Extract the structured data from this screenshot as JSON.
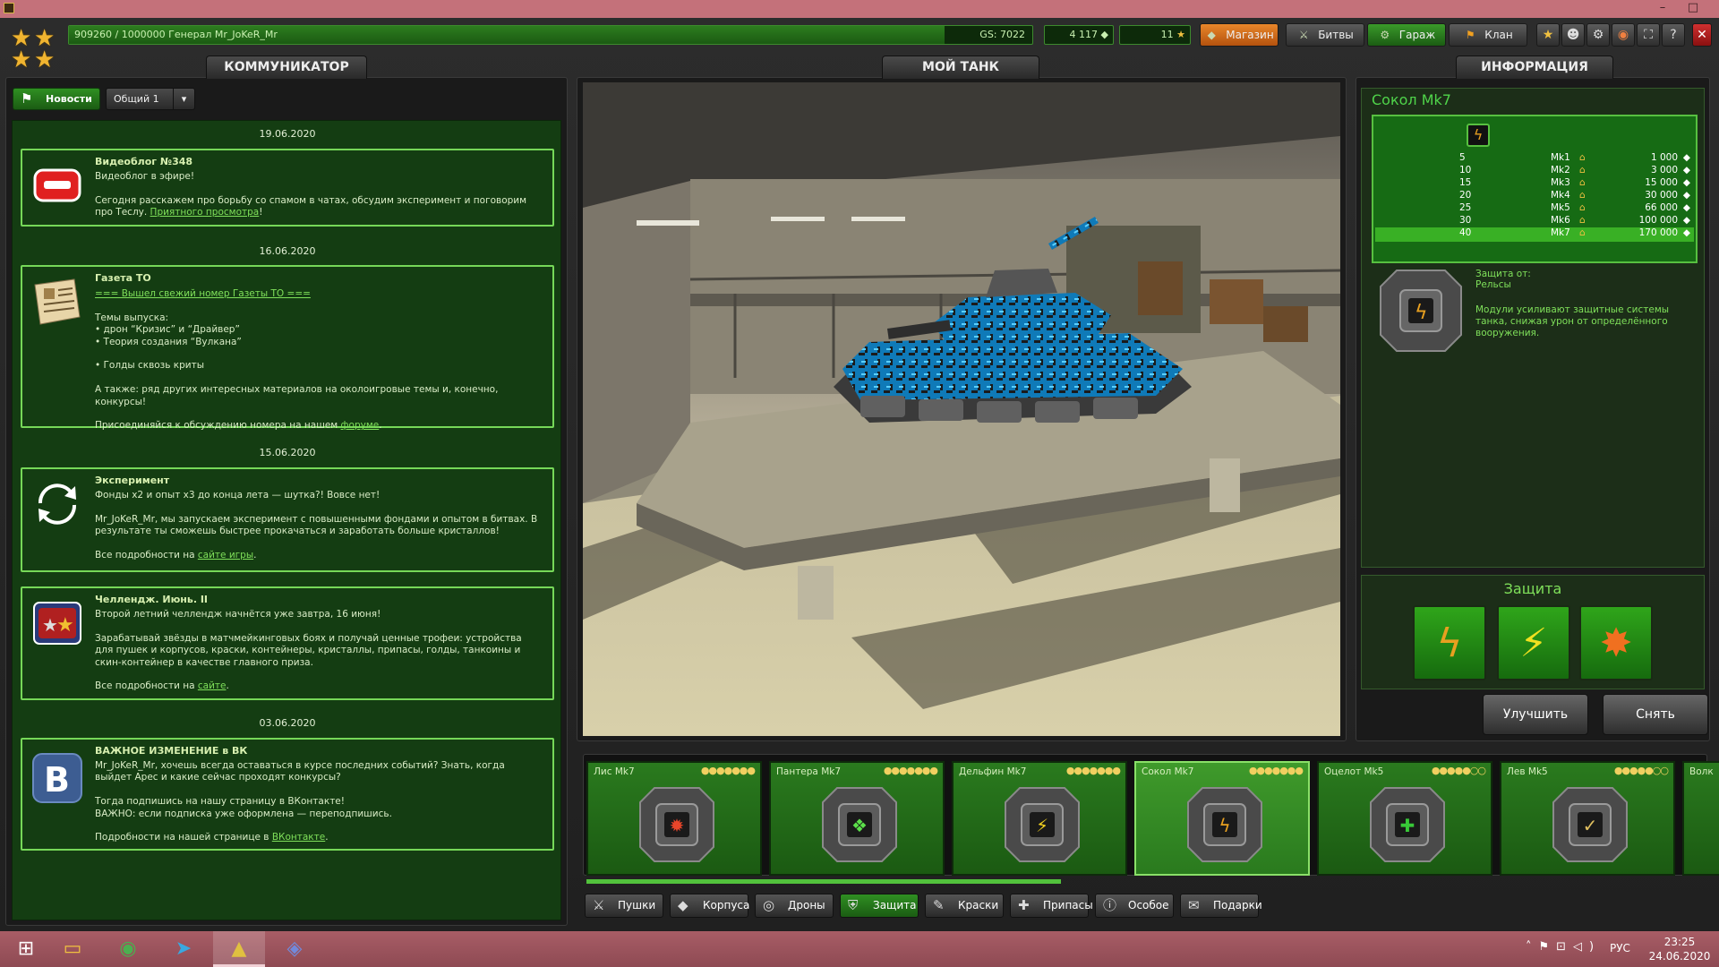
{
  "titlebar": {
    "minimize": "–",
    "maximize": "□",
    "close": "✕"
  },
  "topbar": {
    "xp_text": "909260 / 1000000  Генерал Mr_JoKeR_Mr",
    "xp_progress": 0.9093,
    "gs": "GS: 7022",
    "crystals": "4 117",
    "stars": "11",
    "nav": [
      {
        "label": "Магазин",
        "icon": "diamond-icon"
      },
      {
        "label": "Битвы",
        "icon": "swords-icon"
      },
      {
        "label": "Гараж",
        "icon": "garage-icon"
      },
      {
        "label": "Клан",
        "icon": "clan-icon"
      }
    ]
  },
  "communicator": {
    "tab": "КОММУНИКАТОР",
    "news_button": "Новости",
    "channel": "Общий 1",
    "entries": [
      {
        "date": "19.06.2020",
        "title": "Видеоблог №348",
        "lines": [
          "Видеоблог в эфире!",
          "",
          "Сегодня расскажем про борьбу со спамом в чатах, обсудим эксперимент и поговорим про Теслу. "
        ],
        "link": "Приятного просмотра",
        "after": "!"
      },
      {
        "date": "16.06.2020",
        "title": "Газета ТО",
        "link_top": "=== Вышел свежий номер Газеты ТО ===",
        "lines": [
          "",
          "Темы выпуска:",
          "• дрон “Кризис” и “Драйвер”",
          "• Теория создания “Вулкана”",
          "",
          "• Голды сквозь криты",
          "",
          "А также: ряд других интересных материалов на околоигровые темы и, конечно, конкурсы!",
          "",
          "Присоединяйся к обсуждению номера на нашем "
        ],
        "link": "форуме",
        "after": "."
      },
      {
        "date": "15.06.2020",
        "title": "Эксперимент",
        "lines": [
          "Фонды x2 и опыт x3 до конца лета — шутка?! Вовсе нет!",
          "",
          "Mr_JoKeR_Mr, мы запускаем эксперимент с повышенными фондами и опытом в битвах. В результате ты сможешь быстрее прокачаться и заработать больше кристаллов!",
          "",
          "Все подробности на "
        ],
        "link": "сайте игры",
        "after": "."
      },
      {
        "date": "",
        "title": "Челлендж. Июнь. II",
        "lines": [
          "Второй летний челлендж начнётся уже завтра, 16 июня!",
          "",
          "Зарабатывай звёзды в матчмейкинговых боях и получай ценные трофеи: устройства для пушек и корпусов, краски, контейнеры, кристаллы, припасы, голды, танкоины и скин-контейнер в качестве главного приза.",
          "",
          "Все подробности на  "
        ],
        "link": "сайте",
        "after": "."
      },
      {
        "date": "03.06.2020",
        "title": "ВАЖНОЕ ИЗМЕНЕНИЕ в ВК",
        "lines": [
          "Mr_JoKeR_Mr, хочешь всегда оставаться в курсе последних событий? Знать, когда выйдет Арес и какие сейчас проходят конкурсы?",
          "",
          "Тогда подпишись на нашу страницу в ВКонтакте!",
          "ВАЖНО: если подписка уже оформлена — переподпишись.",
          "",
          "Подробности на нашей странице в "
        ],
        "link": "ВКонтакте",
        "after": "."
      }
    ]
  },
  "tank": {
    "tab": "МОЙ ТАНК"
  },
  "info": {
    "tab": "ИНФОРМАЦИЯ",
    "name": "Сокол Mk7",
    "upgrades": [
      {
        "rank": "5",
        "mk": "Mk1",
        "price": "1 000"
      },
      {
        "rank": "10",
        "mk": "Mk2",
        "price": "3 000"
      },
      {
        "rank": "15",
        "mk": "Mk3",
        "price": "15 000"
      },
      {
        "rank": "20",
        "mk": "Mk4",
        "price": "30 000"
      },
      {
        "rank": "25",
        "mk": "Mk5",
        "price": "66 000"
      },
      {
        "rank": "30",
        "mk": "Mk6",
        "price": "100 000"
      },
      {
        "rank": "40",
        "mk": "Mk7",
        "price": "170 000"
      }
    ],
    "protection_label": "Защита от:",
    "protection_value": "Рельсы",
    "description": "Модули усиливают защитные системы танка, снижая урон от определённого вооружения.",
    "defense_title": "Защита",
    "upgrade_button": "Улучшить",
    "remove_button": "Снять"
  },
  "carousel": {
    "items": [
      {
        "name": "Лис Mk7",
        "dots": "●●●●●●●",
        "icon": "fire-icon",
        "color": "#e8452a"
      },
      {
        "name": "Пантера Mk7",
        "dots": "●●●●●●●",
        "icon": "acid-icon",
        "color": "#5be04a"
      },
      {
        "name": "Дельфин Mk7",
        "dots": "●●●●●●●",
        "icon": "lightning-icon",
        "color": "#f0d020"
      },
      {
        "name": "Сокол Mk7",
        "dots": "●●●●●●●",
        "icon": "railgun-icon",
        "color": "#e8a020"
      },
      {
        "name": "Оцелот Mk5",
        "dots": "●●●●●○○",
        "icon": "plus-icon",
        "color": "#38c838"
      },
      {
        "name": "Лев Mk5",
        "dots": "●●●●●○○",
        "icon": "hammer-icon",
        "color": "#e0c060"
      },
      {
        "name": "Волк",
        "dots": "",
        "icon": "",
        "color": "#888"
      }
    ],
    "categories": [
      {
        "label": "Пушки",
        "icon": "gun-icon"
      },
      {
        "label": "Корпуса",
        "icon": "hull-icon"
      },
      {
        "label": "Дроны",
        "icon": "drone-icon"
      },
      {
        "label": "Защита",
        "icon": "shield-icon"
      },
      {
        "label": "Краски",
        "icon": "brush-icon"
      },
      {
        "label": "Припасы",
        "icon": "supply-icon"
      },
      {
        "label": "Особое",
        "icon": "special-icon"
      },
      {
        "label": "Подарки",
        "icon": "gift-icon"
      }
    ]
  },
  "taskbar": {
    "time": "23:25",
    "date": "24.06.2020",
    "lang": "РУС"
  }
}
